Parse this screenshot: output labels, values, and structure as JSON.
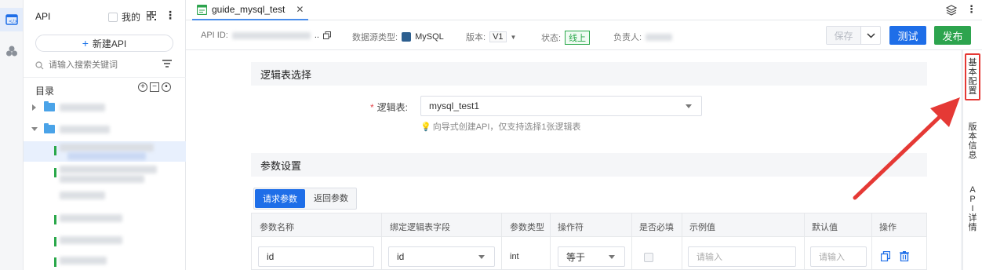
{
  "rail": {
    "items": [
      "api-icon",
      "cluster-icon"
    ]
  },
  "sidebar": {
    "title": "API",
    "mine_label": "我的",
    "new_api_label": "新建API",
    "search_placeholder": "请输入搜索关键词",
    "directory_label": "目录"
  },
  "tab": {
    "label": "guide_mysql_test",
    "close": "✕"
  },
  "info": {
    "api_id_label": "API ID:",
    "api_id_suffix": "..",
    "datasource_label": "数据源类型:",
    "datasource_value": "MySQL",
    "version_label": "版本:",
    "version_value": "V1",
    "status_label": "状态:",
    "status_value": "线上",
    "owner_label": "负责人:"
  },
  "toolbar": {
    "save_label": "保存",
    "test_label": "测试",
    "publish_label": "发布"
  },
  "section1": {
    "title": "逻辑表选择",
    "required_mark": "*",
    "field_label": "逻辑表:",
    "field_value": "mysql_test1",
    "hint": "向导式创建API，仅支持选择1张逻辑表"
  },
  "section2": {
    "title": "参数设置",
    "tabs": [
      "请求参数",
      "返回参数"
    ],
    "headers": [
      "参数名称",
      "绑定逻辑表字段",
      "参数类型",
      "操作符",
      "是否必填",
      "示例值",
      "默认值",
      "操作"
    ],
    "row": {
      "name": "id",
      "field": "id",
      "type": "int",
      "operator": "等于",
      "example_placeholder": "请输入",
      "default_placeholder": "请输入"
    }
  },
  "side_tabs": [
    {
      "chars": [
        "基",
        "本",
        "配",
        "置"
      ]
    },
    {
      "chars": [
        "版",
        "本",
        "信",
        "息"
      ]
    },
    {
      "chars": [
        "A",
        "P",
        "I",
        "详",
        "情"
      ]
    }
  ],
  "colors": {
    "primary": "#1e6ee8",
    "success": "#2da44e",
    "annotation": "#e53935"
  }
}
